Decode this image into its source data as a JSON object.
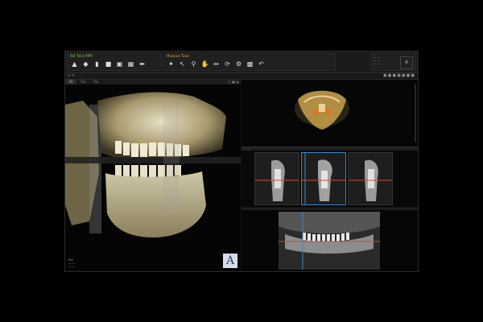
{
  "toolbar": {
    "group1_label": "Ref. Slice  MPR",
    "group2_label": "Measure  Tools",
    "group1_icons": [
      "tooth-icon",
      "teeth-icon",
      "sep",
      "implant-icon",
      "crown-icon",
      "cube-icon",
      "layout-icon",
      "arrow-left-icon"
    ],
    "group2_icons": [
      "select-icon",
      "cursor-icon",
      "zoom-icon",
      "pan-icon",
      "distance-icon",
      "rotate-icon",
      "gear-icon",
      "trash-icon",
      "undo-icon"
    ],
    "info_lines": [
      "— —",
      "— —",
      "— —"
    ],
    "mini_label": "A"
  },
  "subbar": {
    "left_text": "☰  ☰",
    "right_icons": "▣▣▣▣▣▣▣"
  },
  "view3d": {
    "tabs": [
      "3D",
      "Tab",
      "Tab"
    ],
    "tools": "▢ ▣ ▤",
    "overlay_lines": [
      "0.0",
      "— —",
      "— —"
    ],
    "orientation_badge": "A"
  },
  "cross": {
    "header": "— —"
  },
  "colors": {
    "bone": "#d8d0b0",
    "accent_blue": "#3a86c8",
    "accent_red": "#c84a3a",
    "group1_label": "#8cc04a",
    "group2_label": "#c9a640"
  }
}
